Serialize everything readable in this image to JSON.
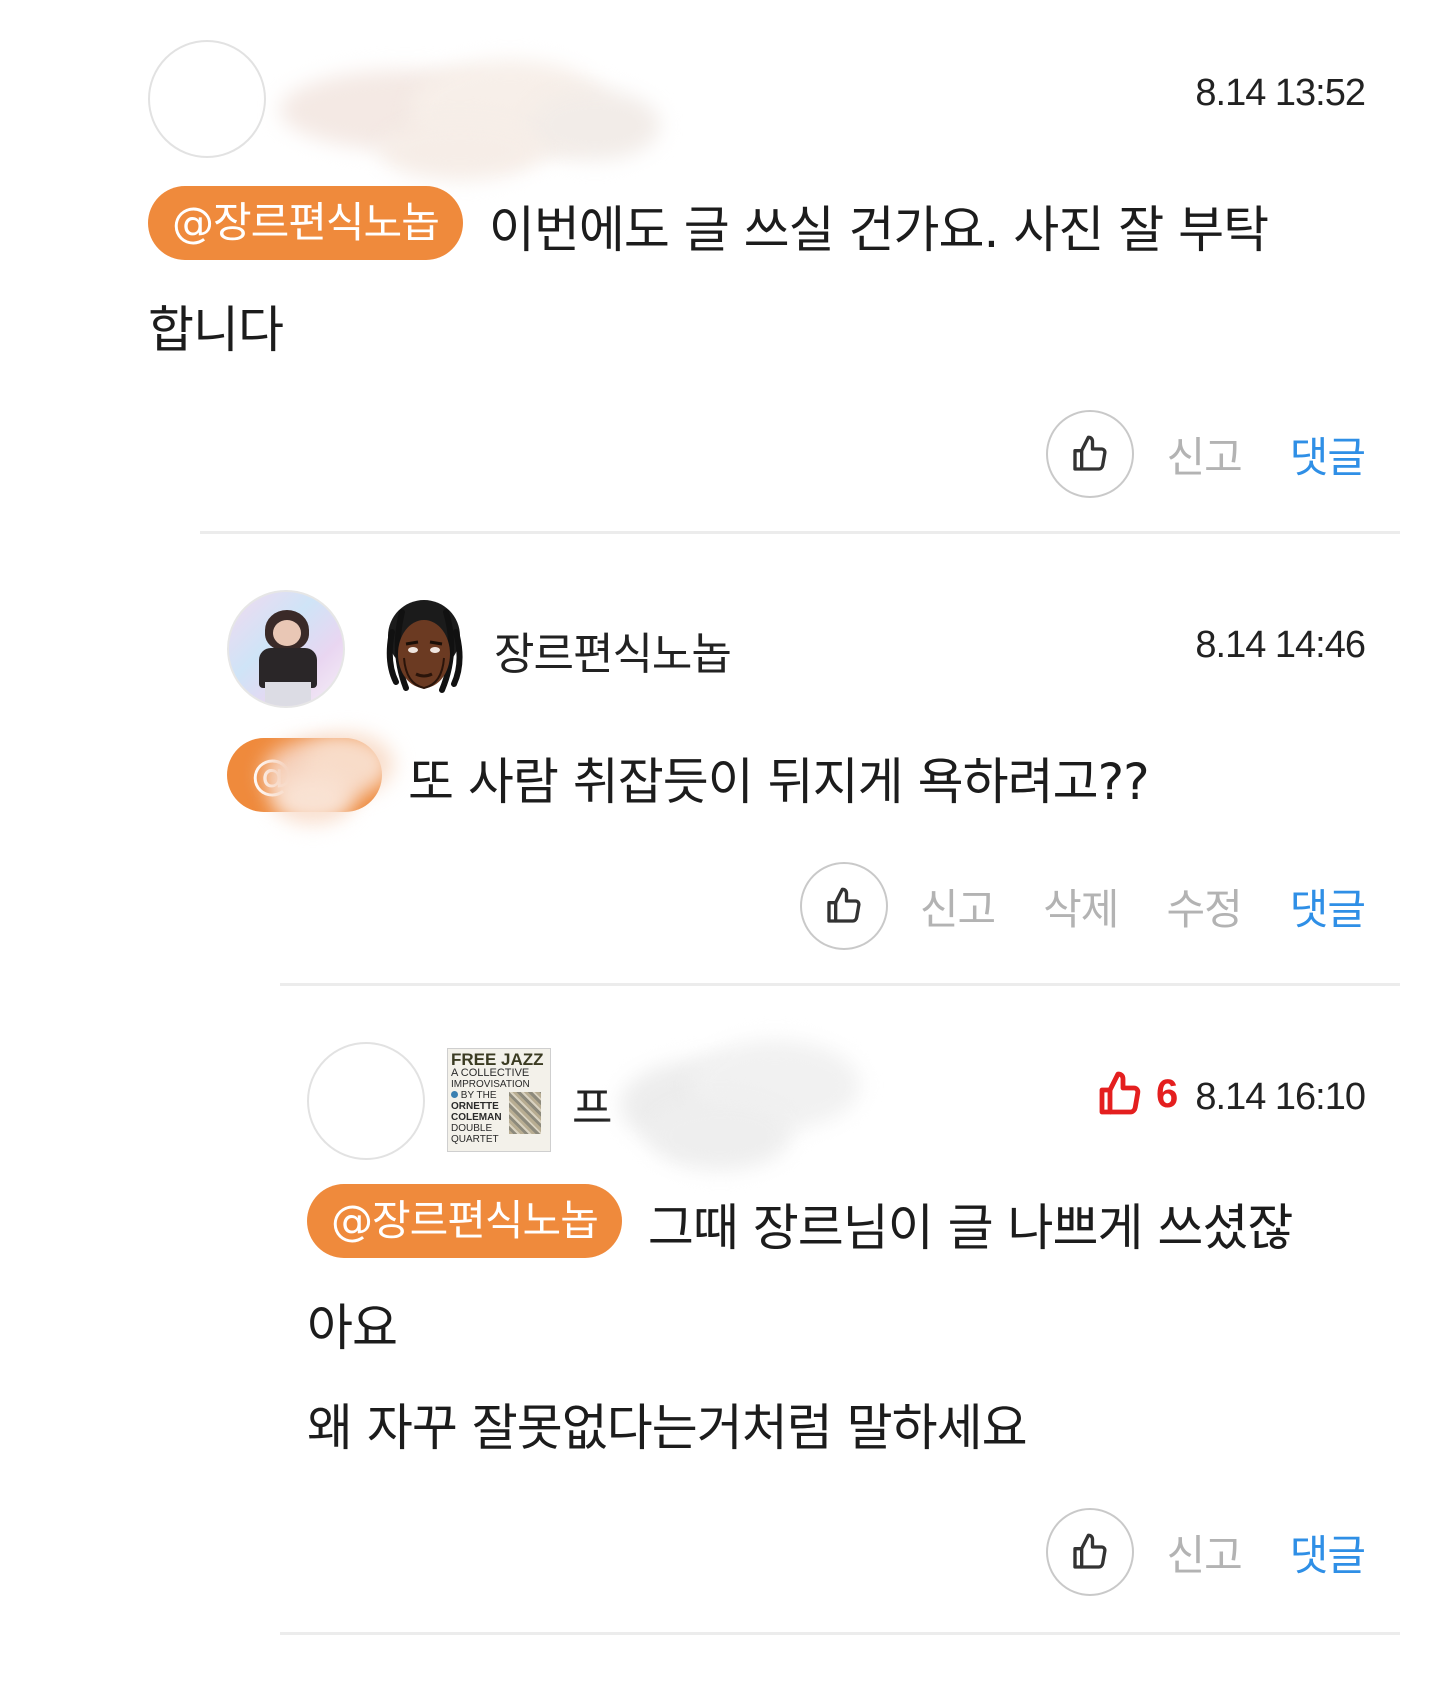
{
  "comments": [
    {
      "timestamp": "8.14 13:52",
      "mention": "@장르편식노놉",
      "text_line1": "이번에도 글 쓰실 건가요. 사진 잘 부탁",
      "text_line2": "합니다",
      "actions": {
        "report": "신고",
        "reply": "댓글"
      }
    },
    {
      "username": "장르편식노놉",
      "timestamp": "8.14 14:46",
      "mention": "@",
      "text": "또 사람 취잡듯이 뒤지게 욕하려고??",
      "actions": {
        "report": "신고",
        "delete": "삭제",
        "edit": "수정",
        "reply": "댓글"
      }
    },
    {
      "username": "프",
      "badge_album": {
        "title": "FREE JAZZ",
        "line1": "A COLLECTIVE",
        "line2": "IMPROVISATION",
        "line3": "BY THE",
        "line4": "ORNETTE",
        "line5": "COLEMAN",
        "line6": "DOUBLE",
        "line7": "QUARTET"
      },
      "likes": "6",
      "timestamp": "8.14 16:10",
      "mention": "@장르편식노놉",
      "text_line1": "그때 장르님이 글 나쁘게 쓰셨잖",
      "text_line2": "아요",
      "text_line3": "왜 자꾸 잘못없다는거처럼 말하세요",
      "actions": {
        "report": "신고",
        "reply": "댓글"
      }
    }
  ],
  "colors": {
    "mention_bg": "#ef8a3c",
    "reply_blue": "#2f8fe6",
    "like_red": "#e41f1f",
    "muted": "#b3b3b3"
  }
}
